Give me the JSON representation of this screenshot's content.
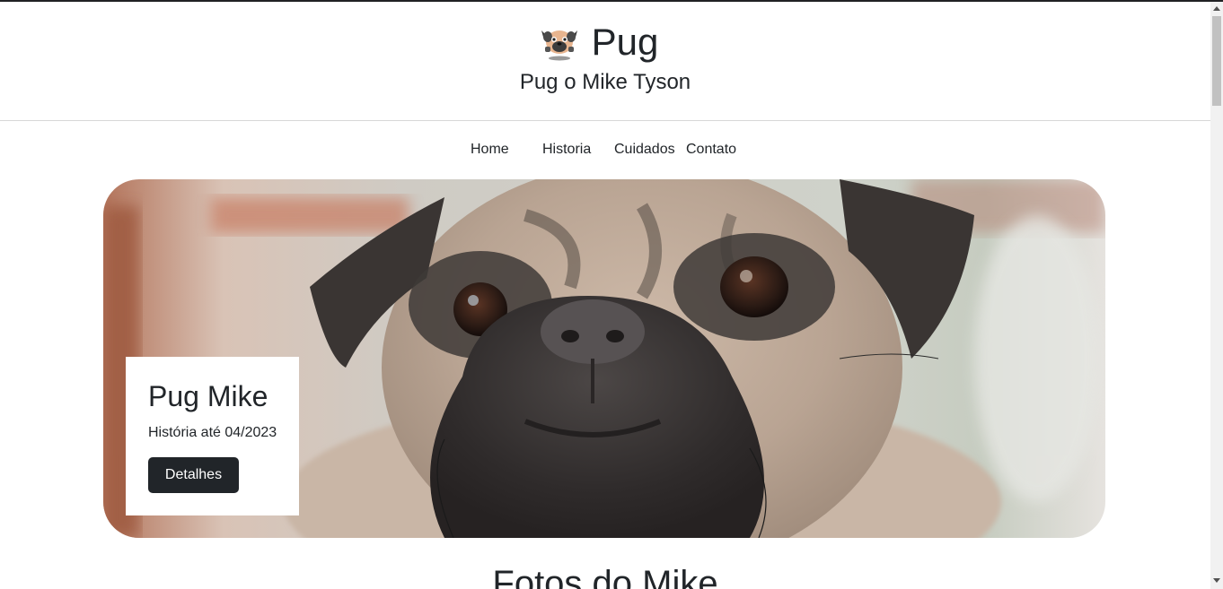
{
  "header": {
    "title": "Pug",
    "subtitle": "Pug o Mike Tyson",
    "logo_icon": "pug-logo-icon"
  },
  "nav": {
    "items": [
      {
        "label": "Home"
      },
      {
        "label": "Historia"
      },
      {
        "label": "Cuidados"
      },
      {
        "label": "Contato"
      }
    ]
  },
  "hero": {
    "image_icon": "pug-photo",
    "card_title": "Pug Mike",
    "card_text": "História até 04/2023",
    "button_label": "Detalhes"
  },
  "section": {
    "heading": "Fotos do Mike"
  },
  "colors": {
    "text": "#212529",
    "button_bg": "#212529",
    "button_text": "#ffffff",
    "divider": "#d7d7d7"
  }
}
